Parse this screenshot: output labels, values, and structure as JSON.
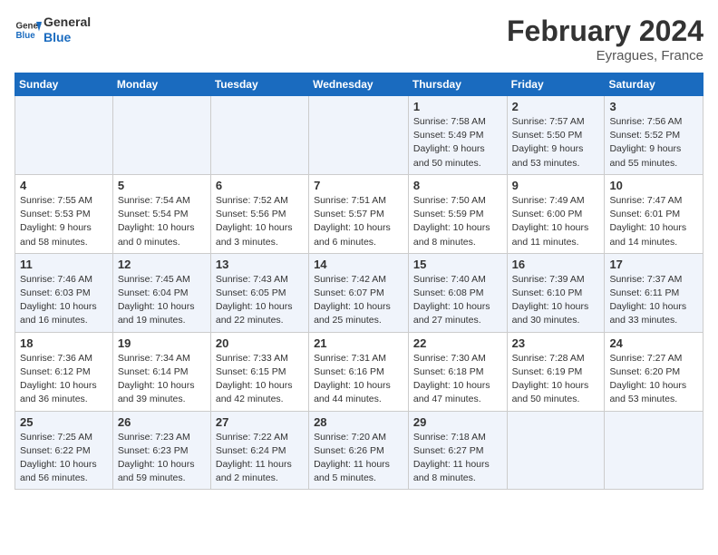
{
  "header": {
    "logo_general": "General",
    "logo_blue": "Blue",
    "month_year": "February 2024",
    "location": "Eyragues, France"
  },
  "columns": [
    "Sunday",
    "Monday",
    "Tuesday",
    "Wednesday",
    "Thursday",
    "Friday",
    "Saturday"
  ],
  "weeks": [
    [
      {
        "day": "",
        "info": ""
      },
      {
        "day": "",
        "info": ""
      },
      {
        "day": "",
        "info": ""
      },
      {
        "day": "",
        "info": ""
      },
      {
        "day": "1",
        "info": "Sunrise: 7:58 AM\nSunset: 5:49 PM\nDaylight: 9 hours\nand 50 minutes."
      },
      {
        "day": "2",
        "info": "Sunrise: 7:57 AM\nSunset: 5:50 PM\nDaylight: 9 hours\nand 53 minutes."
      },
      {
        "day": "3",
        "info": "Sunrise: 7:56 AM\nSunset: 5:52 PM\nDaylight: 9 hours\nand 55 minutes."
      }
    ],
    [
      {
        "day": "4",
        "info": "Sunrise: 7:55 AM\nSunset: 5:53 PM\nDaylight: 9 hours\nand 58 minutes."
      },
      {
        "day": "5",
        "info": "Sunrise: 7:54 AM\nSunset: 5:54 PM\nDaylight: 10 hours\nand 0 minutes."
      },
      {
        "day": "6",
        "info": "Sunrise: 7:52 AM\nSunset: 5:56 PM\nDaylight: 10 hours\nand 3 minutes."
      },
      {
        "day": "7",
        "info": "Sunrise: 7:51 AM\nSunset: 5:57 PM\nDaylight: 10 hours\nand 6 minutes."
      },
      {
        "day": "8",
        "info": "Sunrise: 7:50 AM\nSunset: 5:59 PM\nDaylight: 10 hours\nand 8 minutes."
      },
      {
        "day": "9",
        "info": "Sunrise: 7:49 AM\nSunset: 6:00 PM\nDaylight: 10 hours\nand 11 minutes."
      },
      {
        "day": "10",
        "info": "Sunrise: 7:47 AM\nSunset: 6:01 PM\nDaylight: 10 hours\nand 14 minutes."
      }
    ],
    [
      {
        "day": "11",
        "info": "Sunrise: 7:46 AM\nSunset: 6:03 PM\nDaylight: 10 hours\nand 16 minutes."
      },
      {
        "day": "12",
        "info": "Sunrise: 7:45 AM\nSunset: 6:04 PM\nDaylight: 10 hours\nand 19 minutes."
      },
      {
        "day": "13",
        "info": "Sunrise: 7:43 AM\nSunset: 6:05 PM\nDaylight: 10 hours\nand 22 minutes."
      },
      {
        "day": "14",
        "info": "Sunrise: 7:42 AM\nSunset: 6:07 PM\nDaylight: 10 hours\nand 25 minutes."
      },
      {
        "day": "15",
        "info": "Sunrise: 7:40 AM\nSunset: 6:08 PM\nDaylight: 10 hours\nand 27 minutes."
      },
      {
        "day": "16",
        "info": "Sunrise: 7:39 AM\nSunset: 6:10 PM\nDaylight: 10 hours\nand 30 minutes."
      },
      {
        "day": "17",
        "info": "Sunrise: 7:37 AM\nSunset: 6:11 PM\nDaylight: 10 hours\nand 33 minutes."
      }
    ],
    [
      {
        "day": "18",
        "info": "Sunrise: 7:36 AM\nSunset: 6:12 PM\nDaylight: 10 hours\nand 36 minutes."
      },
      {
        "day": "19",
        "info": "Sunrise: 7:34 AM\nSunset: 6:14 PM\nDaylight: 10 hours\nand 39 minutes."
      },
      {
        "day": "20",
        "info": "Sunrise: 7:33 AM\nSunset: 6:15 PM\nDaylight: 10 hours\nand 42 minutes."
      },
      {
        "day": "21",
        "info": "Sunrise: 7:31 AM\nSunset: 6:16 PM\nDaylight: 10 hours\nand 44 minutes."
      },
      {
        "day": "22",
        "info": "Sunrise: 7:30 AM\nSunset: 6:18 PM\nDaylight: 10 hours\nand 47 minutes."
      },
      {
        "day": "23",
        "info": "Sunrise: 7:28 AM\nSunset: 6:19 PM\nDaylight: 10 hours\nand 50 minutes."
      },
      {
        "day": "24",
        "info": "Sunrise: 7:27 AM\nSunset: 6:20 PM\nDaylight: 10 hours\nand 53 minutes."
      }
    ],
    [
      {
        "day": "25",
        "info": "Sunrise: 7:25 AM\nSunset: 6:22 PM\nDaylight: 10 hours\nand 56 minutes."
      },
      {
        "day": "26",
        "info": "Sunrise: 7:23 AM\nSunset: 6:23 PM\nDaylight: 10 hours\nand 59 minutes."
      },
      {
        "day": "27",
        "info": "Sunrise: 7:22 AM\nSunset: 6:24 PM\nDaylight: 11 hours\nand 2 minutes."
      },
      {
        "day": "28",
        "info": "Sunrise: 7:20 AM\nSunset: 6:26 PM\nDaylight: 11 hours\nand 5 minutes."
      },
      {
        "day": "29",
        "info": "Sunrise: 7:18 AM\nSunset: 6:27 PM\nDaylight: 11 hours\nand 8 minutes."
      },
      {
        "day": "",
        "info": ""
      },
      {
        "day": "",
        "info": ""
      }
    ]
  ]
}
